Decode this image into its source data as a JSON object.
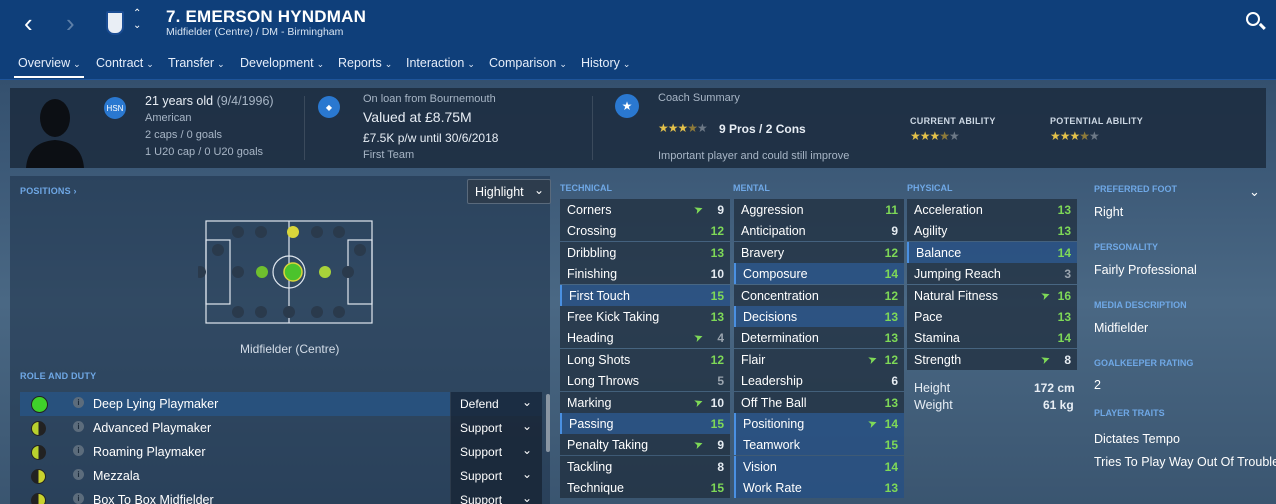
{
  "header": {
    "title": "7. EMERSON HYNDMAN",
    "subtitle": "Midfielder (Centre) / DM - Birmingham"
  },
  "tabs": [
    {
      "label": "Overview"
    },
    {
      "label": "Contract"
    },
    {
      "label": "Transfer"
    },
    {
      "label": "Development"
    },
    {
      "label": "Reports"
    },
    {
      "label": "Interaction"
    },
    {
      "label": "Comparison"
    },
    {
      "label": "History"
    }
  ],
  "info": {
    "age": "21 years old",
    "dob": "(9/4/1996)",
    "nationality": "American",
    "caps": "2 caps / 0 goals",
    "u20": "1 U20 cap / 0 U20 goals",
    "nation_badge": "HSN",
    "loan": "On loan from Bournemouth",
    "value": "Valued at £8.75M",
    "wage": "£7.5K p/w until 30/6/2018",
    "squad": "First Team",
    "coach_title": "Coach Summary",
    "pros_cons": "9 Pros / 2 Cons",
    "coach_note": "Important player and could still improve",
    "coach_stars": 3.5,
    "ca_label": "CURRENT ABILITY",
    "ca_stars": 3.5,
    "pa_label": "POTENTIAL ABILITY",
    "pa_stars": 3.5
  },
  "positions": {
    "header": "POSITIONS ›",
    "highlight": "Highlight",
    "position_label": "Midfielder (Centre)"
  },
  "roles": {
    "header": "ROLE AND DUTY",
    "items": [
      {
        "name": "Deep Lying Playmaker",
        "duty": "Defend"
      },
      {
        "name": "Advanced Playmaker",
        "duty": "Support"
      },
      {
        "name": "Roaming Playmaker",
        "duty": "Support"
      },
      {
        "name": "Mezzala",
        "duty": "Support"
      },
      {
        "name": "Box To Box Midfielder",
        "duty": "Support"
      }
    ]
  },
  "technical": {
    "header": "TECHNICAL",
    "items": [
      {
        "name": "Corners",
        "value": "9",
        "arrow": true
      },
      {
        "name": "Crossing",
        "value": "12"
      },
      {
        "name": "Dribbling",
        "value": "13"
      },
      {
        "name": "Finishing",
        "value": "10"
      },
      {
        "name": "First Touch",
        "value": "15",
        "hl": true
      },
      {
        "name": "Free Kick Taking",
        "value": "13"
      },
      {
        "name": "Heading",
        "value": "4",
        "arrow": true
      },
      {
        "name": "Long Shots",
        "value": "12"
      },
      {
        "name": "Long Throws",
        "value": "5"
      },
      {
        "name": "Marking",
        "value": "10",
        "arrow": true
      },
      {
        "name": "Passing",
        "value": "15",
        "hl": true
      },
      {
        "name": "Penalty Taking",
        "value": "9",
        "arrow": true
      },
      {
        "name": "Tackling",
        "value": "8"
      },
      {
        "name": "Technique",
        "value": "15"
      }
    ]
  },
  "mental": {
    "header": "MENTAL",
    "items": [
      {
        "name": "Aggression",
        "value": "11"
      },
      {
        "name": "Anticipation",
        "value": "9"
      },
      {
        "name": "Bravery",
        "value": "12"
      },
      {
        "name": "Composure",
        "value": "14",
        "hl": true
      },
      {
        "name": "Concentration",
        "value": "12"
      },
      {
        "name": "Decisions",
        "value": "13",
        "hl": true
      },
      {
        "name": "Determination",
        "value": "13"
      },
      {
        "name": "Flair",
        "value": "12",
        "arrow": true
      },
      {
        "name": "Leadership",
        "value": "6"
      },
      {
        "name": "Off The Ball",
        "value": "13"
      },
      {
        "name": "Positioning",
        "value": "14",
        "arrow": true,
        "hl": true
      },
      {
        "name": "Teamwork",
        "value": "15",
        "hl": true
      },
      {
        "name": "Vision",
        "value": "14",
        "hl": true
      },
      {
        "name": "Work Rate",
        "value": "13",
        "hl": true
      }
    ]
  },
  "physical": {
    "header": "PHYSICAL",
    "items": [
      {
        "name": "Acceleration",
        "value": "13"
      },
      {
        "name": "Agility",
        "value": "13"
      },
      {
        "name": "Balance",
        "value": "14",
        "hl": true
      },
      {
        "name": "Jumping Reach",
        "value": "3"
      },
      {
        "name": "Natural Fitness",
        "value": "16",
        "arrow": true
      },
      {
        "name": "Pace",
        "value": "13"
      },
      {
        "name": "Stamina",
        "value": "14"
      },
      {
        "name": "Strength",
        "value": "8",
        "arrow": true
      }
    ],
    "height_label": "Height",
    "height": "172 cm",
    "weight_label": "Weight",
    "weight": "61 kg"
  },
  "right": {
    "foot_label": "PREFERRED FOOT",
    "foot": "Right",
    "personality_label": "PERSONALITY",
    "personality": "Fairly Professional",
    "media_label": "MEDIA DESCRIPTION",
    "media": "Midfielder",
    "gk_label": "GOALKEEPER RATING",
    "gk": "2",
    "traits_label": "PLAYER TRAITS",
    "traits": [
      "Dictates Tempo",
      "Tries To Play Way Out Of Trouble"
    ]
  }
}
